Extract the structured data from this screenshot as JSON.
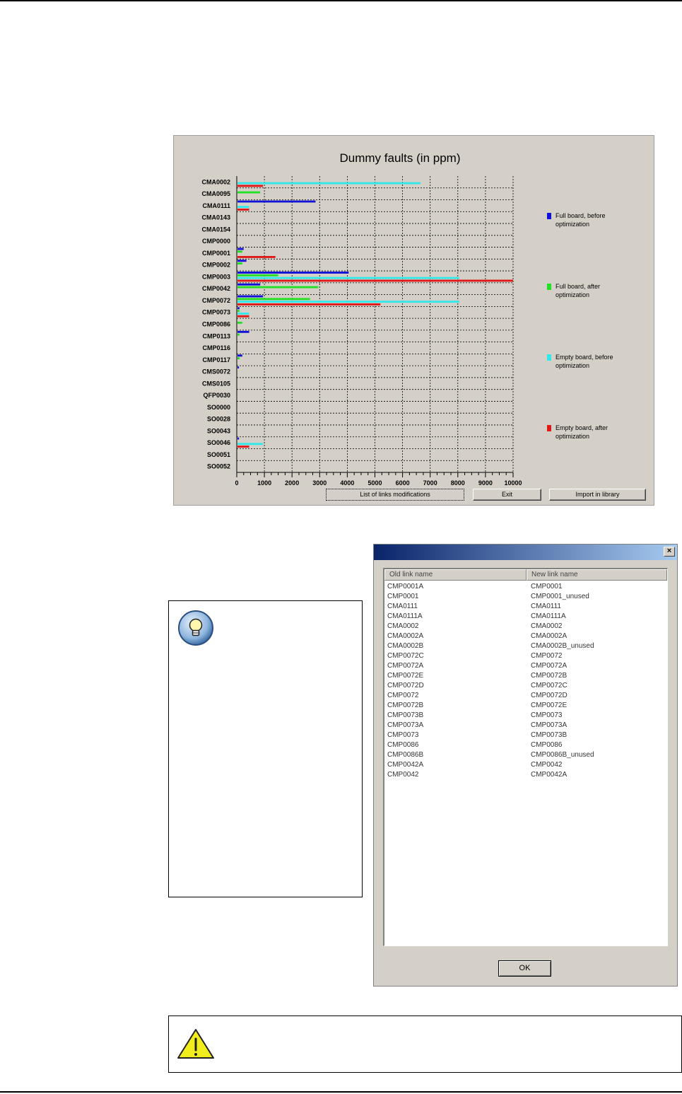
{
  "chart_data": {
    "type": "bar",
    "orientation": "horizontal",
    "title": "Dummy faults (in ppm)",
    "xlim": [
      0,
      10000
    ],
    "xticks": [
      0,
      1000,
      2000,
      3000,
      4000,
      5000,
      6000,
      7000,
      8000,
      9000,
      10000
    ],
    "grid": true,
    "legend_position": "right",
    "categories": [
      "CMA0002",
      "CMA0095",
      "CMA0111",
      "CMA0143",
      "CMA0154",
      "CMP0000",
      "CMP0001",
      "CMP0002",
      "CMP0003",
      "CMP0042",
      "CMP0072",
      "CMP0073",
      "CMP0086",
      "CMP0113",
      "CMP0116",
      "CMP0117",
      "CMS0072",
      "CMS0105",
      "QFP0030",
      "SO0000",
      "SO0028",
      "SO0043",
      "SO0046",
      "SO0051",
      "SO0052"
    ],
    "series": [
      {
        "name": "Full board, before optimization",
        "color": "#1010d8",
        "values": [
          0,
          0,
          2850,
          0,
          0,
          0,
          250,
          350,
          4050,
          850,
          950,
          100,
          0,
          450,
          0,
          200,
          80,
          0,
          0,
          0,
          0,
          0,
          80,
          0,
          0
        ]
      },
      {
        "name": "Full board, after optimization",
        "color": "#22e022",
        "values": [
          0,
          850,
          0,
          0,
          0,
          0,
          200,
          200,
          1500,
          2950,
          2650,
          100,
          200,
          100,
          0,
          100,
          0,
          0,
          0,
          0,
          0,
          0,
          0,
          0,
          0
        ]
      },
      {
        "name": "Empty board, before optimization",
        "color": "#33e8e8",
        "values": [
          6650,
          0,
          450,
          0,
          0,
          0,
          0,
          0,
          8050,
          0,
          8050,
          450,
          0,
          0,
          0,
          0,
          0,
          0,
          0,
          0,
          0,
          0,
          950,
          0,
          0
        ]
      },
      {
        "name": "Empty board, after optimization",
        "color": "#e01818",
        "values": [
          950,
          0,
          450,
          0,
          0,
          0,
          1400,
          0,
          10000,
          0,
          5200,
          450,
          0,
          0,
          0,
          0,
          0,
          0,
          0,
          0,
          0,
          0,
          450,
          0,
          0
        ]
      }
    ]
  },
  "chart_buttons": {
    "list_label": "List of links modifications",
    "exit_label": "Exit",
    "import_label": "Import in library"
  },
  "link_dialog": {
    "close_label": "×",
    "col_old": "Old link name",
    "col_new": "New link name",
    "rows": [
      [
        "CMP0001A",
        "CMP0001"
      ],
      [
        "CMP0001",
        "CMP0001_unused"
      ],
      [
        "CMA0111",
        "CMA0111"
      ],
      [
        "CMA0111A",
        "CMA0111A"
      ],
      [
        "CMA0002",
        "CMA0002"
      ],
      [
        "CMA0002A",
        "CMA0002A"
      ],
      [
        "CMA0002B",
        "CMA0002B_unused"
      ],
      [
        "CMP0072C",
        "CMP0072"
      ],
      [
        "CMP0072A",
        "CMP0072A"
      ],
      [
        "CMP0072E",
        "CMP0072B"
      ],
      [
        "CMP0072D",
        "CMP0072C"
      ],
      [
        "CMP0072",
        "CMP0072D"
      ],
      [
        "CMP0072B",
        "CMP0072E"
      ],
      [
        "CMP0073B",
        "CMP0073"
      ],
      [
        "CMP0073A",
        "CMP0073A"
      ],
      [
        "CMP0073",
        "CMP0073B"
      ],
      [
        "CMP0086",
        "CMP0086"
      ],
      [
        "CMP0086B",
        "CMP0086B_unused"
      ],
      [
        "CMP0042A",
        "CMP0042"
      ],
      [
        "CMP0042",
        "CMP0042A"
      ]
    ],
    "ok_label": "OK"
  },
  "icons": {
    "tip": "lightbulb-icon",
    "warning": "warning-triangle-icon"
  }
}
